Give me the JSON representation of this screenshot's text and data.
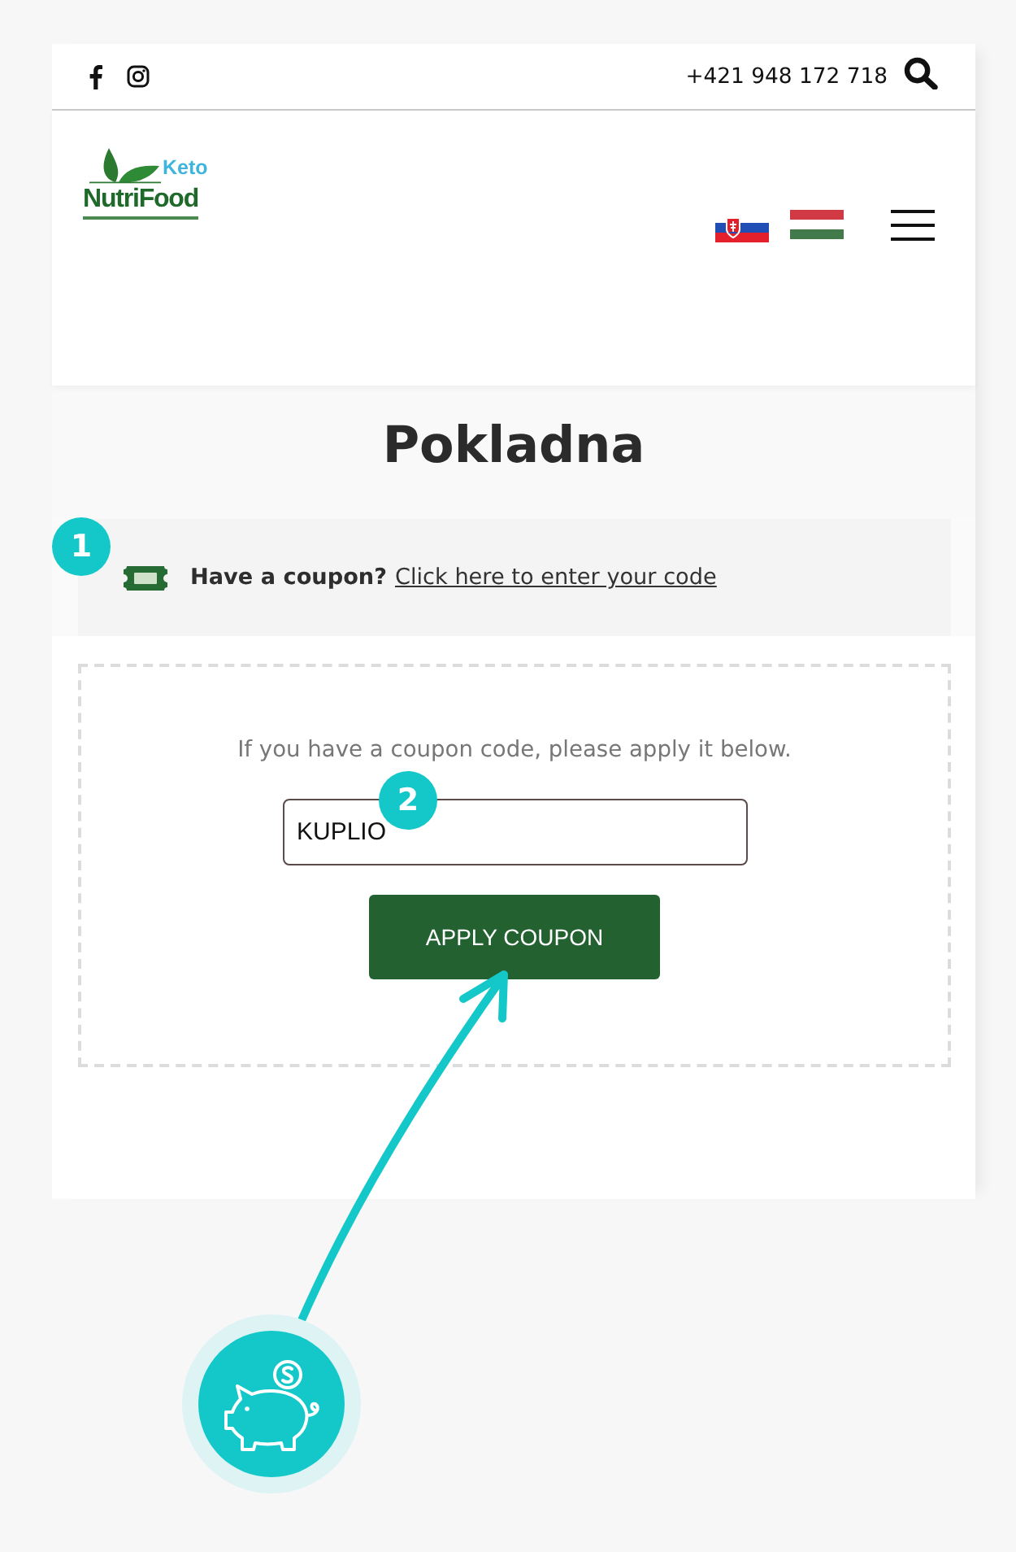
{
  "top_bar": {
    "phone": "+421 948 172 718"
  },
  "header": {
    "logo": {
      "accent": "Keto",
      "wordmark": "NutriFood"
    }
  },
  "page_title": "Pokladna",
  "coupon_notice": {
    "question": "Have a coupon?",
    "link": "Click here to enter your code"
  },
  "coupon_form": {
    "instruction": "If you have a coupon code, please apply it below.",
    "code_field": {
      "value": "KUPLIO"
    },
    "button": "APPLY COUPON"
  },
  "annotations": [
    {
      "label": "1"
    },
    {
      "label": "2"
    }
  ]
}
